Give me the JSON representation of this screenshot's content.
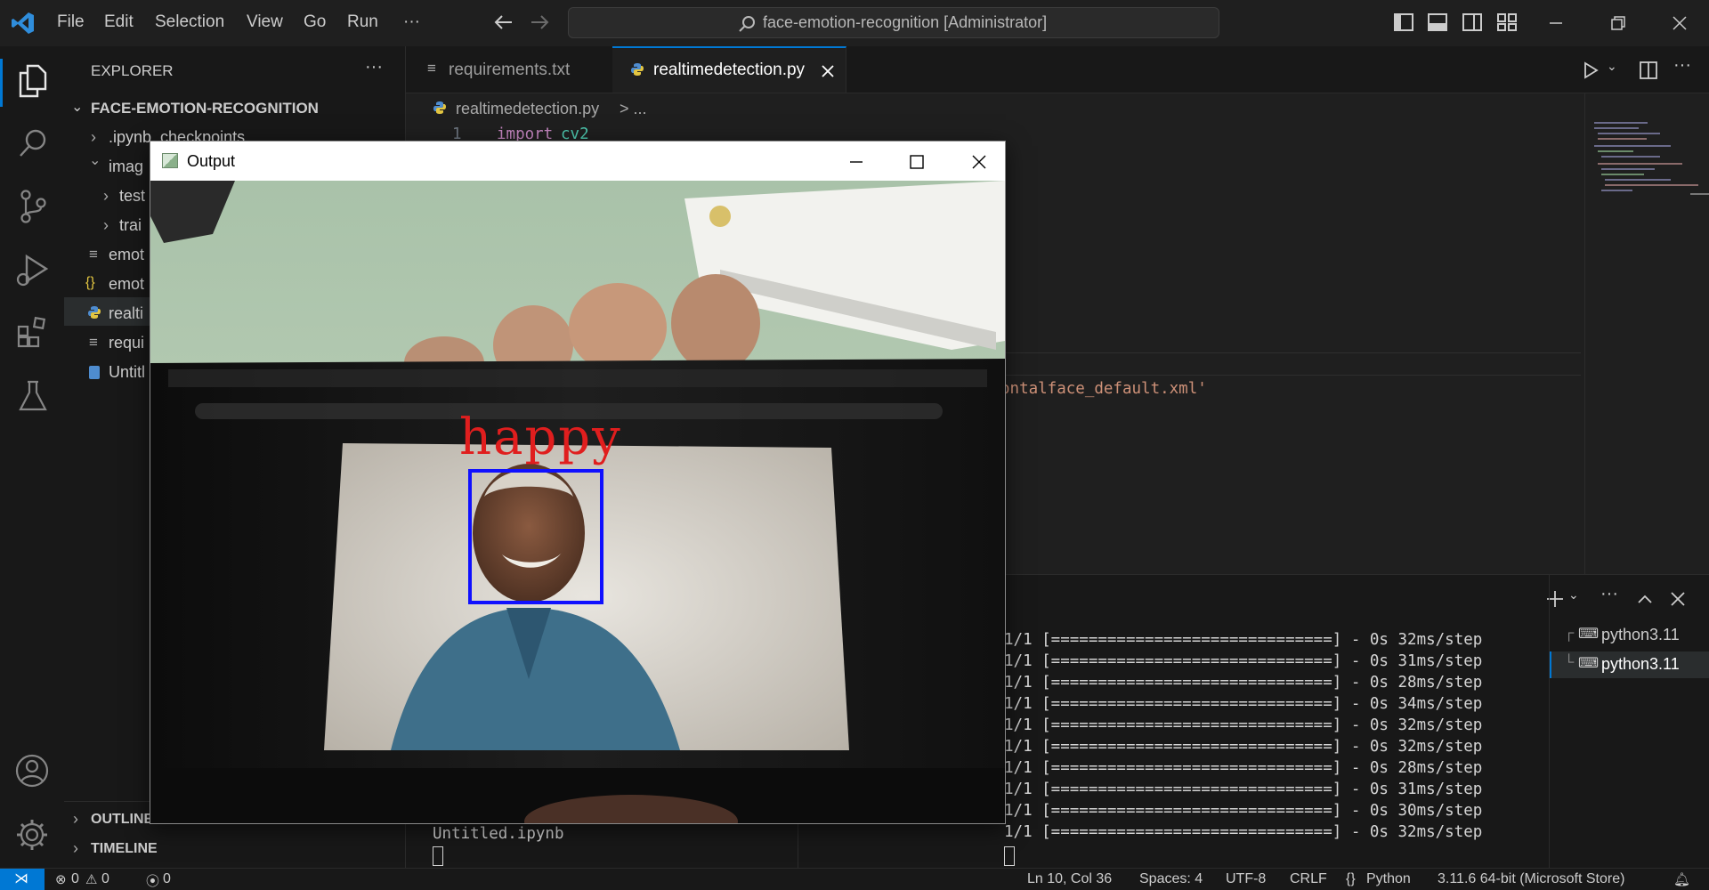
{
  "menu": [
    "File",
    "Edit",
    "Selection",
    "View",
    "Go",
    "Run",
    "···"
  ],
  "command_center": "face-emotion-recognition [Administrator]",
  "sidebar": {
    "title": "EXPLORER",
    "root": "FACE-EMOTION-RECOGNITION",
    "items": [
      ".ipynb_checkpoints",
      "imag",
      "test",
      "trai",
      "emot",
      "emot",
      "realti",
      "requi",
      "Untitl"
    ],
    "outline": "OUTLINE",
    "timeline": "TIMELINE"
  },
  "tabs": [
    {
      "label": "requirements.txt",
      "icon": "text-file-icon"
    },
    {
      "label": "realtimedetection.py",
      "icon": "python-icon"
    }
  ],
  "breadcrumb": {
    "file": "realtimedetection.py",
    "rest": "> ..."
  },
  "editor": {
    "line1_number": "1",
    "line1_keyword": "import",
    "line1_module": "cv2",
    "visible_string": "ontalface_default.xml'"
  },
  "output_window": {
    "title": "Output",
    "label": "happy"
  },
  "terminal": {
    "left_name": "Untitled.ipynb",
    "lines": [
      "1/1 [==============================] - 0s 32ms/step",
      "1/1 [==============================] - 0s 31ms/step",
      "1/1 [==============================] - 0s 28ms/step",
      "1/1 [==============================] - 0s 34ms/step",
      "1/1 [==============================] - 0s 32ms/step",
      "1/1 [==============================] - 0s 32ms/step",
      "1/1 [==============================] - 0s 28ms/step",
      "1/1 [==============================] - 0s 31ms/step",
      "1/1 [==============================] - 0s 30ms/step",
      "1/1 [==============================] - 0s 32ms/step"
    ],
    "instances": [
      "python3.11",
      "python3.11"
    ]
  },
  "status": {
    "errors": "0",
    "warnings": "0",
    "ports": "0",
    "position": "Ln 10, Col 36",
    "spaces": "Spaces: 4",
    "encoding": "UTF-8",
    "eol": "CRLF",
    "language": "Python",
    "interpreter": "3.11.6 64-bit (Microsoft Store)"
  },
  "colors": {
    "accent": "#0078d4",
    "bbox": "#1010ff",
    "label": "#e01e1e"
  }
}
